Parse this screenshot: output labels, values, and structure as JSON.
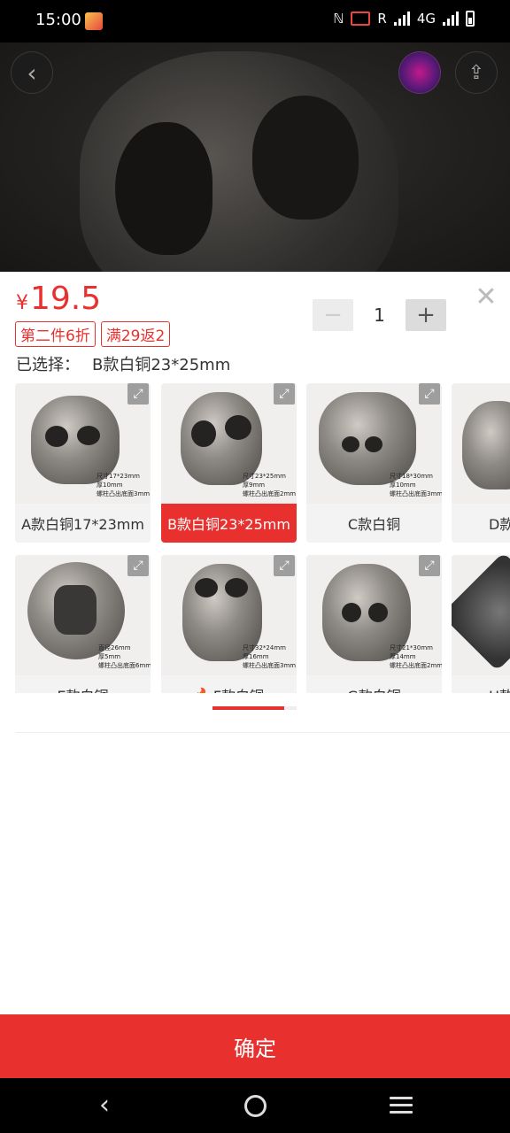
{
  "status_bar": {
    "time": "15:00",
    "network": "R",
    "network_type": "4G",
    "icons": [
      "app-notification-icon",
      "nfc-icon",
      "cast-icon",
      "signal-icon",
      "signal-4g-icon",
      "battery-icon"
    ]
  },
  "hero": {
    "back_icon": "chevron-left-icon",
    "avatar_icon": "avatar-icon",
    "share_icon": "share-icon"
  },
  "product": {
    "price_symbol": "¥",
    "price_value": "19.5",
    "tags": [
      "第二件6折",
      "满29返2"
    ],
    "selected_label": "已选择：",
    "selected_value": "B款白铜23*25mm",
    "quantity": "1",
    "minus_label": "−",
    "plus_label": "+",
    "close_icon": "close-icon"
  },
  "variants": [
    {
      "label": "A款白铜17*23mm",
      "selected": false,
      "hot": false,
      "size_lines": [
        "尺寸17*23mm",
        "厚10mm",
        "螺柱凸出底面3mm"
      ]
    },
    {
      "label": "B款白铜23*25mm",
      "selected": true,
      "hot": false,
      "size_lines": [
        "尺寸23*25mm",
        "厚9mm",
        "螺柱凸出底面2mm"
      ]
    },
    {
      "label": "C款白铜",
      "selected": false,
      "hot": false,
      "size_lines": [
        "尺寸18*30mm",
        "厚10mm",
        "螺柱凸出底面3mm"
      ]
    },
    {
      "label": "D款",
      "selected": false,
      "hot": false,
      "size_lines": []
    },
    {
      "label": "E款白铜",
      "selected": false,
      "hot": false,
      "size_lines": [
        "直径26mm",
        "厚5mm",
        "螺柱凸出底面6mm"
      ]
    },
    {
      "label": "F款白铜",
      "selected": false,
      "hot": true,
      "size_lines": [
        "尺寸32*24mm",
        "厚16mm",
        "螺柱凸出底面3mm"
      ]
    },
    {
      "label": "G款白铜",
      "selected": false,
      "hot": false,
      "size_lines": [
        "尺寸21*30mm",
        "厚14mm",
        "螺柱凸出底面2mm"
      ]
    },
    {
      "label": "H款",
      "selected": false,
      "hot": false,
      "size_lines": []
    }
  ],
  "confirm_label": "确定",
  "colors": {
    "accent": "#e8312f",
    "status_bar": "#000000",
    "nav_bar": "#000000"
  },
  "nav": {
    "back_icon": "nav-back-icon",
    "home_icon": "nav-home-icon",
    "menu_icon": "nav-menu-icon"
  }
}
